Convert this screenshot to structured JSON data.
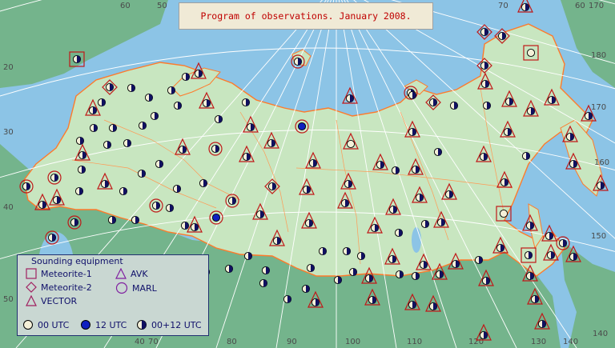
{
  "title": "Program of observations. January 2008.",
  "legend": {
    "title": "Sounding equipment",
    "meteorite1": "Meteorite-1",
    "meteorite2": "Meteorite-2",
    "vector": "VECTOR",
    "avk": "AVK",
    "marl": "MARL",
    "utc00": "00 UTC",
    "utc12": "12 UTC",
    "utc0012": "00+12 UTC"
  },
  "grid_labels": {
    "top": [
      "60",
      "50",
      "70",
      "60",
      "170"
    ],
    "left": [
      "20",
      "30",
      "40",
      "50"
    ],
    "bottom": [
      "40",
      "70",
      "80",
      "90",
      "100",
      "110",
      "120",
      "130",
      "140"
    ],
    "right": [
      "180",
      "170",
      "160",
      "150",
      "140"
    ]
  },
  "colors": {
    "sea": "#8cc4e6",
    "land": "#74b48c",
    "russia": "#c8e6c0",
    "border": "#ff7a2a",
    "station": "#1a1a8a",
    "equipment": "#c01818"
  }
}
